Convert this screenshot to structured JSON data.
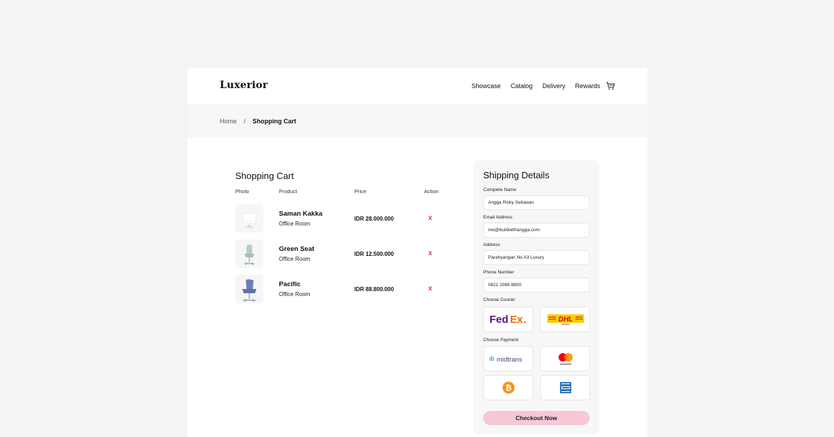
{
  "brand": {
    "logo_pre": "Lu",
    "logo_x": "x",
    "logo_post": "erior"
  },
  "nav": {
    "items": [
      "Showcase",
      "Catalog",
      "Delivery",
      "Rewards"
    ],
    "cart_icon": "cart-icon"
  },
  "breadcrumb": {
    "home": "Home",
    "separator": "/",
    "current": "Shopping Cart"
  },
  "cart": {
    "title": "Shopping Cart",
    "columns": {
      "photo": "Photo",
      "product": "Product",
      "price": "Price",
      "action": "Action"
    },
    "items": [
      {
        "name": "Saman Kakka",
        "room": "Office Room",
        "price": "IDR 28.000.000",
        "remove": "x"
      },
      {
        "name": "Green Seat",
        "room": "Office Room",
        "price": "IDR 12.500.000",
        "remove": "x"
      },
      {
        "name": "Pacific",
        "room": "Office Room",
        "price": "IDR 88.800.000",
        "remove": "x"
      }
    ]
  },
  "shipping": {
    "title": "Shipping Details",
    "name_label": "Complete Name",
    "name_value": "Angga Risky Setiawan",
    "email_label": "Email Address",
    "email_value": "me@buildwithangga.com",
    "address_label": "Address",
    "address_value": "Parahyangan No A3 Luxury",
    "phone_label": "Phone Number",
    "phone_value": "0821 2089 8800",
    "courier_label": "Choose Courier",
    "couriers": [
      "FedEx",
      "DHL"
    ],
    "payment_label": "Choose Payment",
    "payments": [
      "midtrans",
      "mastercard",
      "bitcoin",
      "amex"
    ],
    "checkout_label": "Checkout Now"
  },
  "colors": {
    "accent_pink": "#f8c7d4",
    "remove_red": "#e0365c",
    "panel_bg": "#f7f7f7"
  }
}
